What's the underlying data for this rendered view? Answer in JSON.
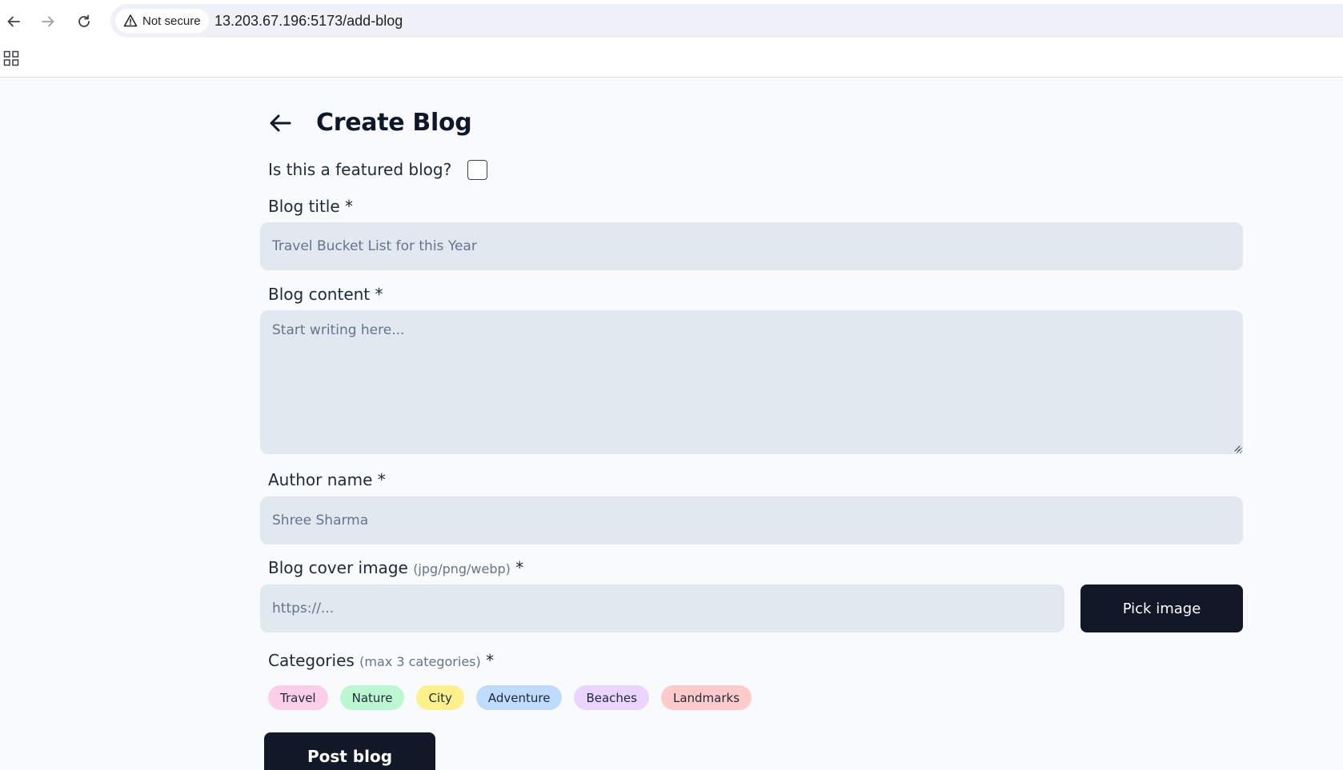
{
  "browser": {
    "security_label": "Not secure",
    "url": "13.203.67.196:5173/add-blog"
  },
  "page": {
    "title": "Create Blog"
  },
  "form": {
    "featured_label": "Is this a featured blog?",
    "featured_checked": false,
    "title_label": "Blog title *",
    "title_placeholder": "Travel Bucket List for this Year",
    "content_label": "Blog content *",
    "content_placeholder": "Start writing here...",
    "author_label": "Author name *",
    "author_placeholder": "Shree Sharma",
    "cover_label": "Blog cover image",
    "cover_hint": "(jpg/png/webp)",
    "cover_required": " *",
    "cover_placeholder": "https://...",
    "pick_image_label": "Pick image",
    "categories_label": "Categories",
    "categories_hint": "(max 3 categories)",
    "categories_required": " *",
    "categories": [
      {
        "label": "Travel",
        "color": "#fbcfe8"
      },
      {
        "label": "Nature",
        "color": "#bbf7d0"
      },
      {
        "label": "City",
        "color": "#fef08a"
      },
      {
        "label": "Adventure",
        "color": "#bfdbfe"
      },
      {
        "label": "Beaches",
        "color": "#e9d5ff"
      },
      {
        "label": "Landmarks",
        "color": "#fecaca"
      }
    ],
    "post_button_label": "Post blog"
  },
  "colors": {
    "primary_button": "#111827",
    "input_bg": "#e2e8f0",
    "page_bg": "#f8fafc"
  }
}
